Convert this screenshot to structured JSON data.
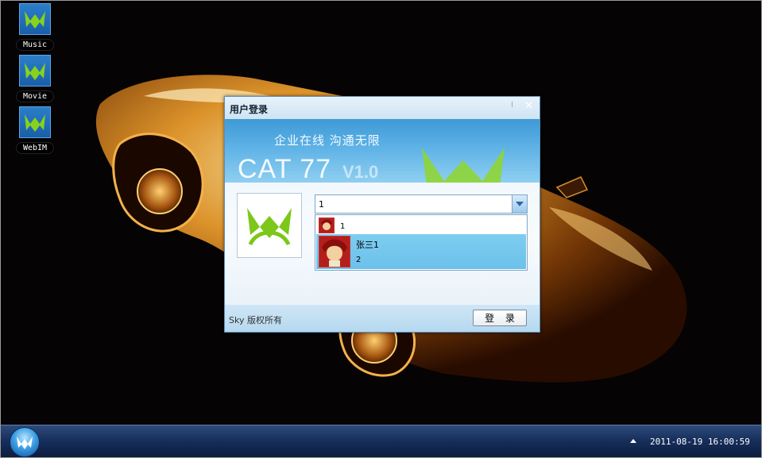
{
  "desktop": {
    "icons": [
      {
        "label": "Music",
        "icon": "app-logo-icon"
      },
      {
        "label": "Movie",
        "icon": "app-logo-icon"
      },
      {
        "label": "WebIM",
        "icon": "app-logo-icon"
      }
    ],
    "wallpaper": "sports-car"
  },
  "login_dialog": {
    "title": "用户登录",
    "slogan": "企业在线  沟通无限",
    "brand": "CAT 77",
    "version": "V1.0",
    "account_combo": {
      "value": "1"
    },
    "dropdown_items": [
      {
        "primary": "1",
        "secondary": ""
      },
      {
        "primary": "张三1",
        "secondary": "2",
        "selected": true
      }
    ],
    "copyright": "Sky 版权所有",
    "login_button": "登 录"
  },
  "taskbar": {
    "clock": "2011-08-19 16:00:59"
  },
  "colors": {
    "accent": "#3e9ad6",
    "logo_green": "#7cc71a",
    "selection": "#7ecdf1"
  }
}
